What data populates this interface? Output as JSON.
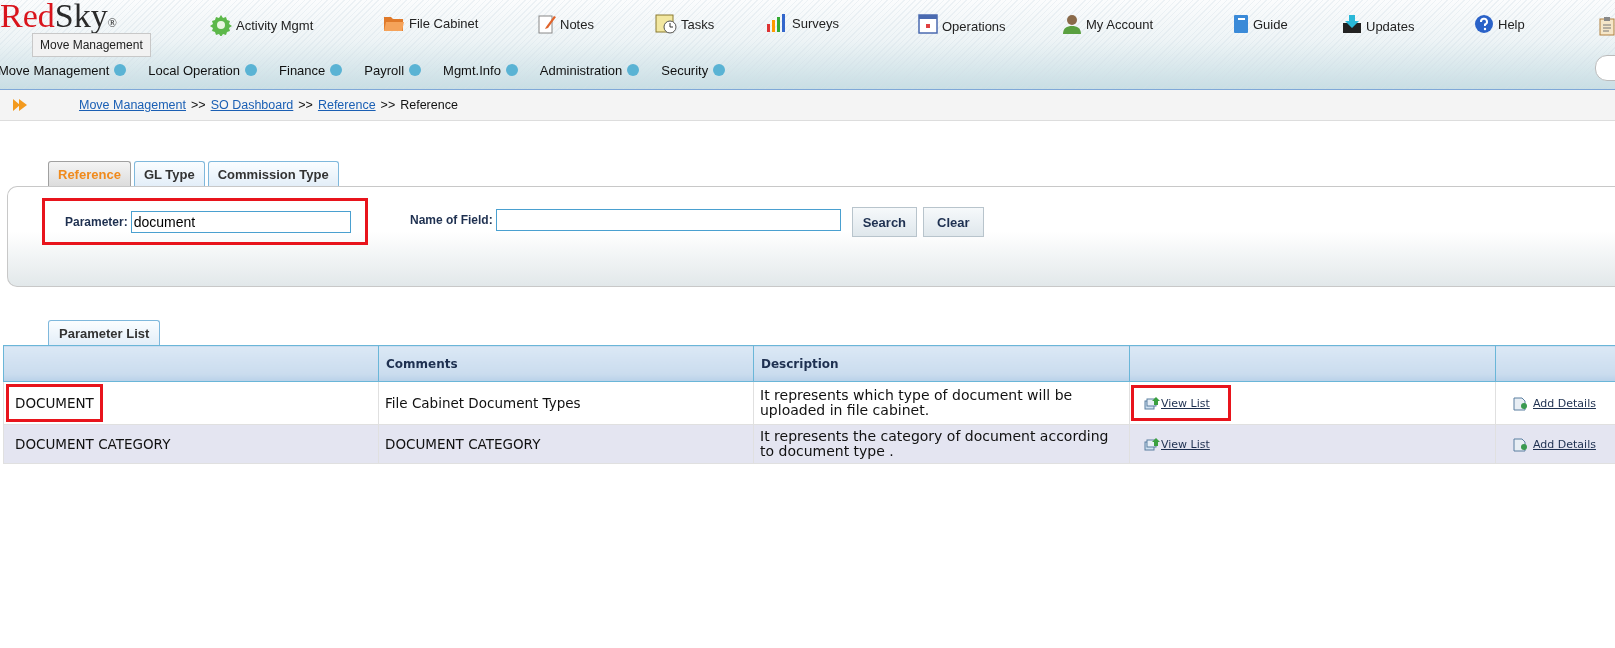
{
  "logo": {
    "first": "Red",
    "second": "Sky",
    "mark": "®"
  },
  "tooltip": "Move Management",
  "top_nav": [
    "Activity Mgmt",
    "File Cabinet",
    "Notes",
    "Tasks",
    "Surveys",
    "Operations",
    "My Account",
    "Guide",
    "Updates",
    "Help"
  ],
  "menu": [
    "Move Management",
    "Local Operation",
    "Finance",
    "Payroll",
    "Mgmt.Info",
    "Administration",
    "Security"
  ],
  "breadcrumb": {
    "links": [
      "Move Management",
      "SO Dashboard",
      "Reference"
    ],
    "separator": ">>",
    "current": "Reference"
  },
  "tabs": [
    {
      "label": "Reference",
      "selected": true
    },
    {
      "label": "GL Type",
      "selected": false
    },
    {
      "label": "Commission Type",
      "selected": false
    }
  ],
  "search": {
    "parameter_label": "Parameter:",
    "parameter_value": "document",
    "parameter_highlighted": true,
    "field_label": "Name of Field:",
    "buttons": [
      "Search",
      "Clear"
    ]
  },
  "list_tab": "Parameter List",
  "table": {
    "columns": [
      "",
      "Comments",
      "Description",
      "",
      ""
    ],
    "rows": [
      {
        "parameter": "DOCUMENT",
        "comments": "File Cabinet Document Types",
        "description": "It represents which type of document will be uploaded in file cabinet.",
        "view": "View List",
        "add": "Add Details",
        "parameter_highlighted": true,
        "view_highlighted": true
      },
      {
        "parameter": "DOCUMENT CATEGORY",
        "comments": "DOCUMENT CATEGORY",
        "description": "It represents the category of document according to document type .",
        "view": "View List",
        "add": "Add Details",
        "parameter_highlighted": false,
        "view_highlighted": false
      }
    ]
  }
}
